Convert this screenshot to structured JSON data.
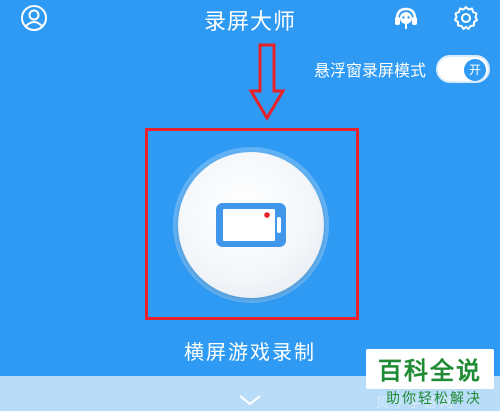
{
  "header": {
    "title": "录屏大师",
    "profile_icon": "profile-icon",
    "service_icon": "headset-icon",
    "settings_icon": "gear-icon"
  },
  "float_mode": {
    "label": "悬浮窗录屏模式",
    "toggle_text": "开",
    "enabled": true
  },
  "record": {
    "icon": "landscape-phone-icon",
    "mode_label": "横屏游戏录制"
  },
  "watermark": {
    "main": "百科全说",
    "sub": "助你轻松解决",
    "faint": "贝平手游网"
  },
  "colors": {
    "background": "#2e9af3",
    "annotation_red": "#e8222a",
    "watermark_green": "#1f8b34"
  }
}
